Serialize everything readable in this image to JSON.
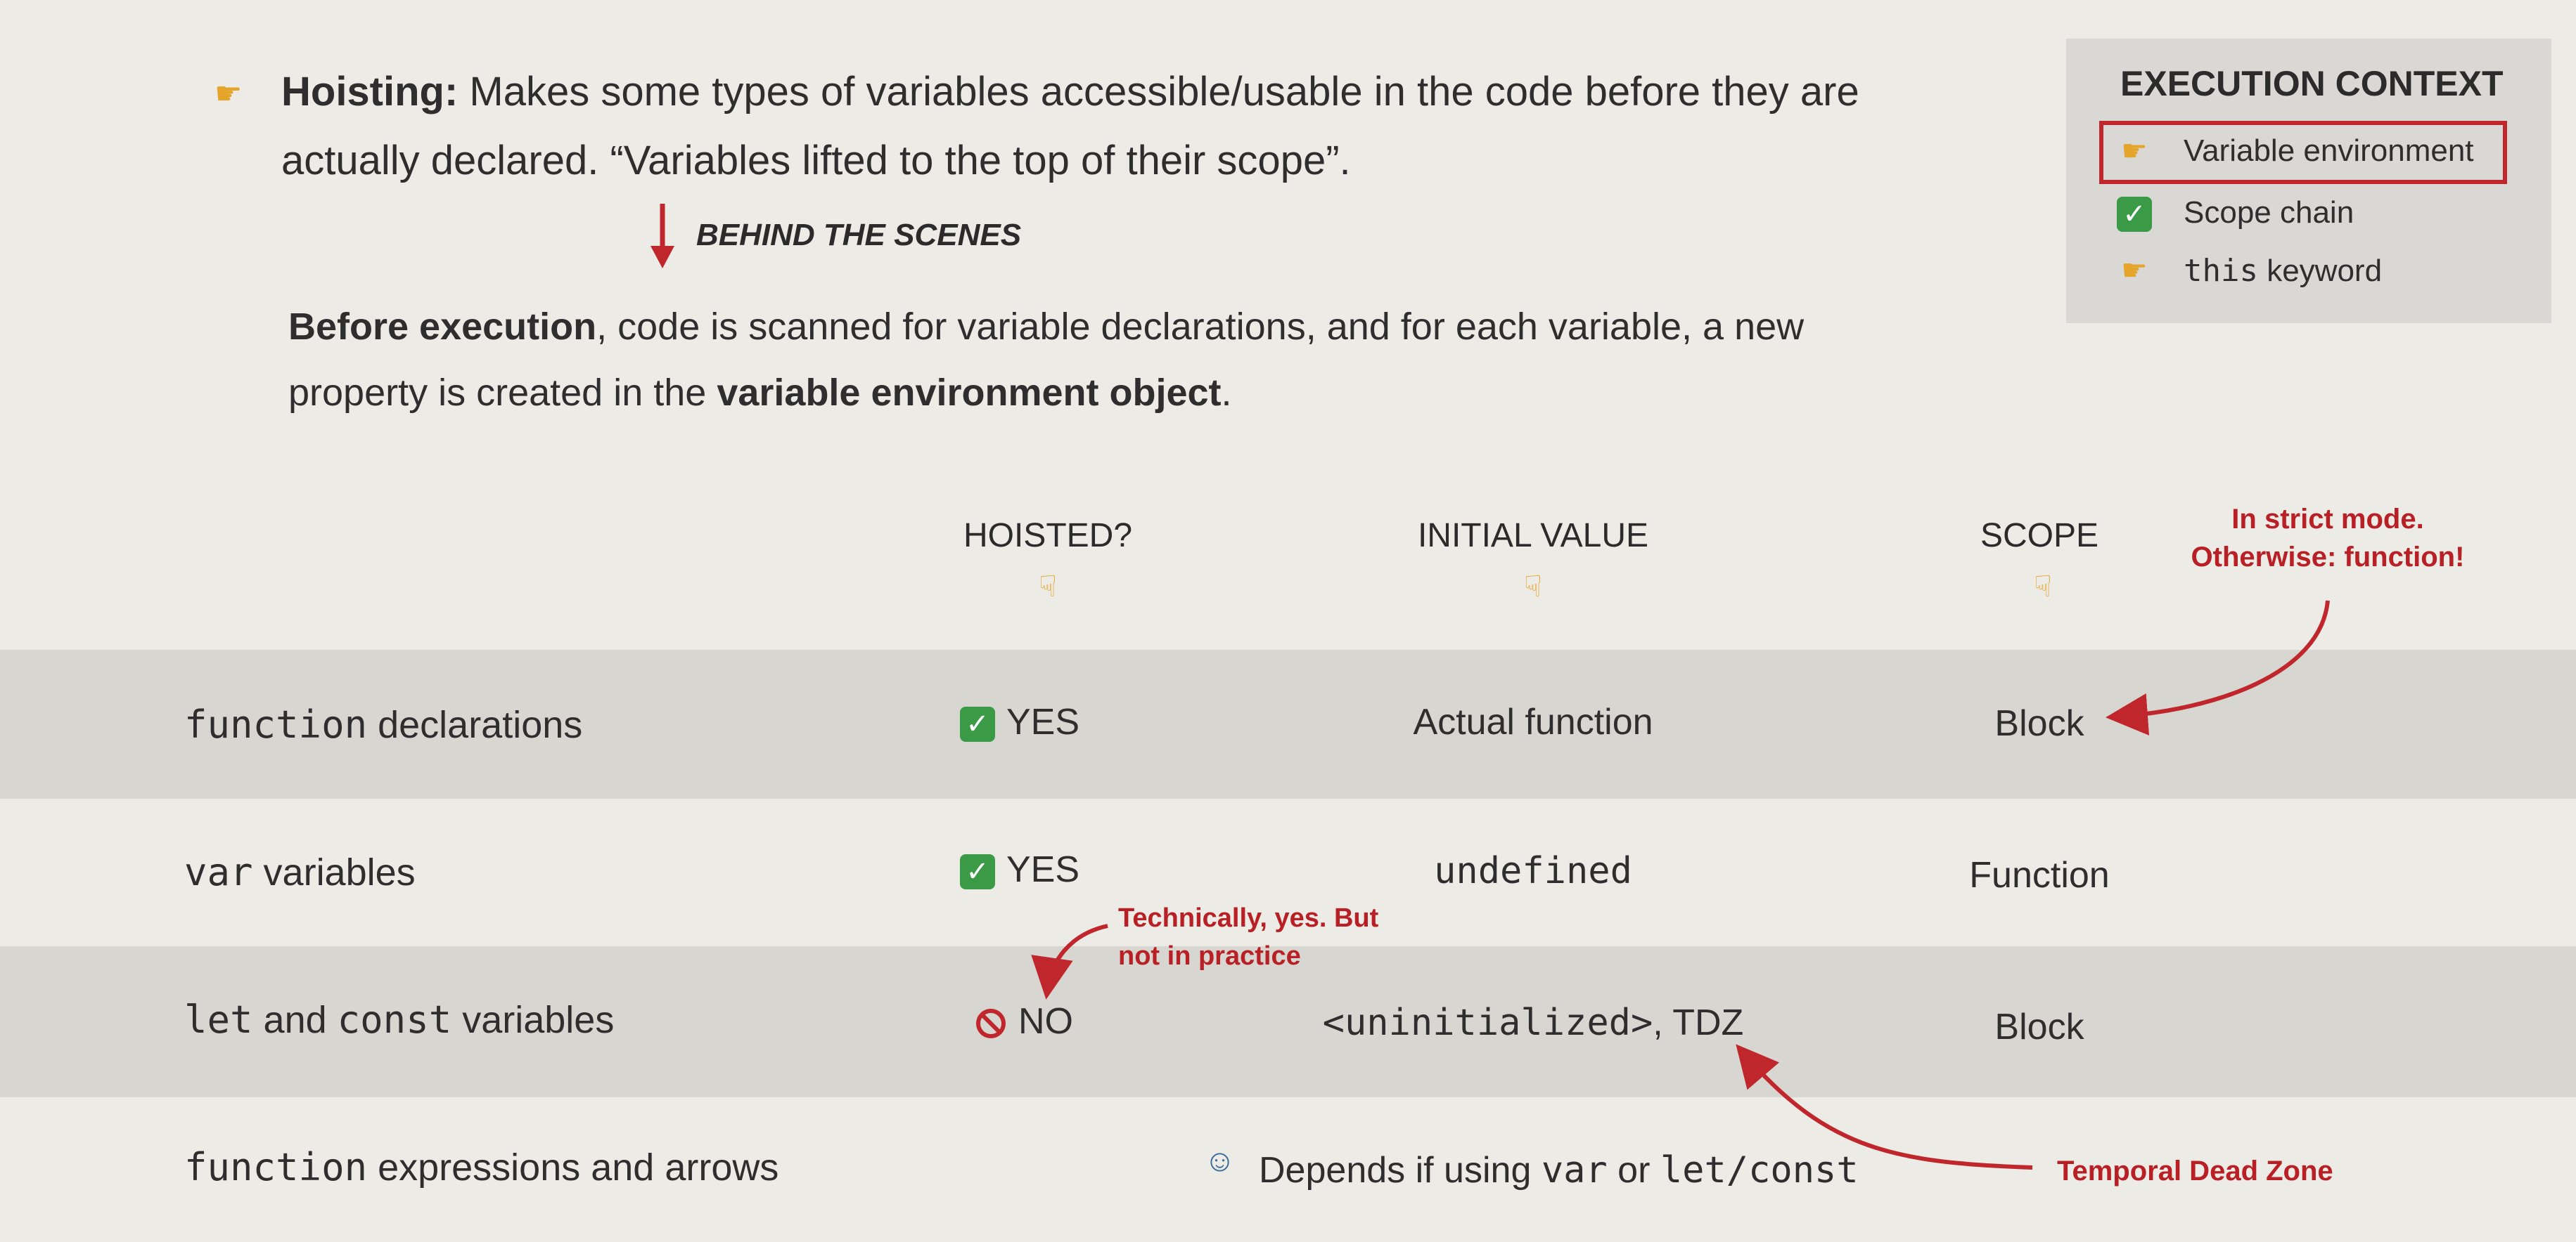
{
  "intro": {
    "hoisting_label": "Hoisting:",
    "hoisting_text_1": " Makes some types of variables accessible/usable in the code before they are",
    "hoisting_text_2": "actually declared. “Variables lifted to the top of their scope”.",
    "behind_label": "BEHIND THE SCENES",
    "before_bold": "Before execution",
    "before_text_1": ", code is scanned for variable declarations, and for each variable, a new",
    "before_text_2": "property is created in the ",
    "before_bold_2": "variable environment object",
    "before_end": "."
  },
  "execution_context": {
    "title": "EXECUTION CONTEXT",
    "items": [
      {
        "icon": "pointing-hand-icon",
        "label": "Variable environment"
      },
      {
        "icon": "check-icon",
        "label": "Scope chain"
      },
      {
        "icon": "pointing-hand-icon",
        "label_code": "this",
        "label": " keyword"
      }
    ]
  },
  "table": {
    "headers": {
      "hoisted": "HOISTED?",
      "initial": "INITIAL VALUE",
      "scope": "SCOPE"
    },
    "rows": [
      {
        "code": "function",
        "label": " declarations",
        "hoisted": "YES",
        "initial": "Actual function",
        "scope": "Block"
      },
      {
        "code": "var",
        "label": " variables",
        "hoisted": "YES",
        "initial_code": "undefined",
        "scope": "Function"
      },
      {
        "code": "let",
        "mid": " and ",
        "code2": "const",
        "label": " variables",
        "hoisted": "NO",
        "initial_code": "<uninitialized>",
        "initial_tail": ", TDZ",
        "scope": "Block"
      },
      {
        "code": "function",
        "label": " expressions and arrows",
        "depends": "Depends if using ",
        "depends_code1": "var",
        "depends_or": " or ",
        "depends_code2": "let/const"
      }
    ]
  },
  "notes": {
    "strict_1": "In strict mode.",
    "strict_2": "Otherwise: function!",
    "technically_1": "Technically, yes. But",
    "technically_2": "not in practice",
    "tdz": "Temporal Dead Zone"
  },
  "colors": {
    "accent_red": "#c0272d",
    "check_green": "#3a9a45",
    "hand_yellow": "#e5a52a"
  }
}
